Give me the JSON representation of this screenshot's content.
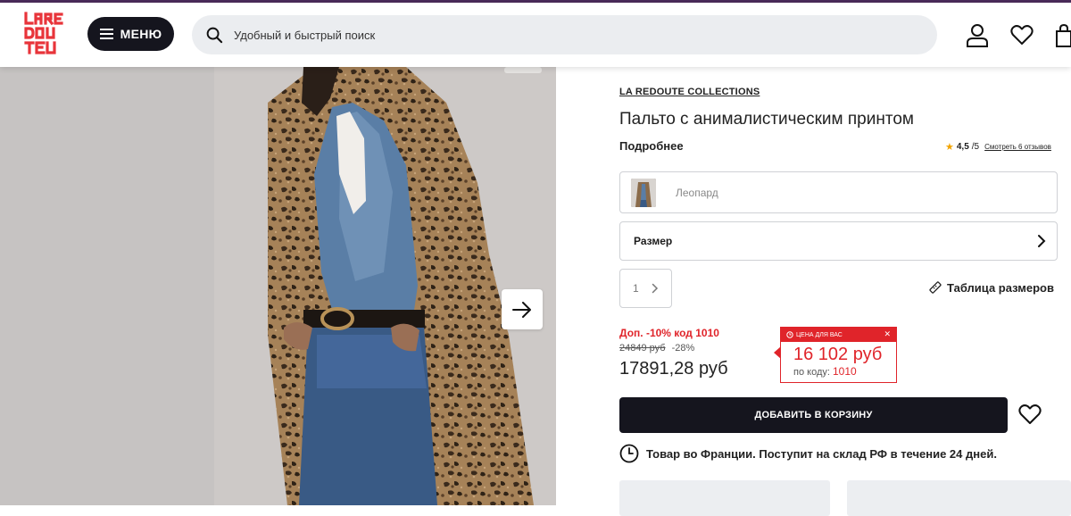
{
  "header": {
    "logo_text": "LA REDOUTE",
    "menu_label": "МЕНЮ",
    "search_placeholder": "Удобный и быстрый поиск"
  },
  "product": {
    "brand": "LA REDOUTE COLLECTIONS",
    "title": "Пальто с анималистическим принтом",
    "more_label": "Подробнее",
    "rating": "4,5",
    "rating_max": "/5",
    "reviews_link": "Смотреть 6 отзывов",
    "color": "Леопард",
    "size_label": "Размер",
    "quantity": "1",
    "size_table_label": "Таблица размеров",
    "promo": "Доп. -10% код 1010",
    "old_price": "24849 руб",
    "discount": "-28%",
    "price": "17891,28 руб",
    "price_card": {
      "header": "ЦЕНА ДЛЯ ВАС",
      "price": "16 102 руб",
      "code_label": "по коду:",
      "code": "1010"
    },
    "add_to_cart": "ДОБАВИТЬ В КОРЗИНУ",
    "delivery": "Товар во Франции. Поступит на склад РФ в течение 24 дней."
  },
  "colors": {
    "accent_red": "#e0242a",
    "dark": "#15151e",
    "logo_red": "#e8343a"
  }
}
